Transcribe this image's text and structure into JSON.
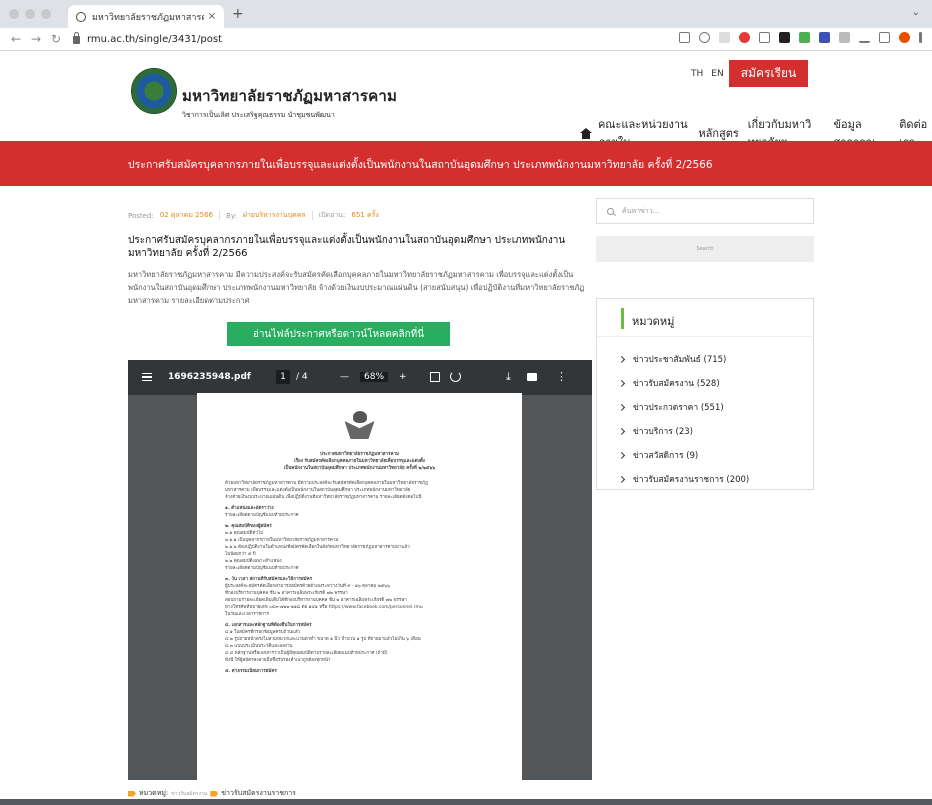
{
  "browser": {
    "tab_title": "มหาวิทยาลัยราชภัฏมหาสารคาม - (",
    "tab_close": "×",
    "new_tab": "+",
    "url": "rmu.ac.th/single/3431/post"
  },
  "header": {
    "brand_name": "มหาวิทยาลัยราชภัฏมหาสารคาม",
    "brand_tagline": "วิชาการเป็นเลิศ ประเสริฐคุณธรรม นำชุมชนพัฒนา",
    "lang_th": "TH",
    "lang_en": "EN",
    "apply_label": "สมัครเรียน",
    "nav": [
      "คณะและหน่วยงานภายใน",
      "หลักสูตร",
      "เกี่ยวกับมหาวิทยาลัยฯ",
      "ข้อมูลสาธารณะ",
      "ติดต่อเรา"
    ]
  },
  "banner": {
    "title": "ประกาศรับสมัครบุคลากรภายในเพื่อบรรจุและแต่งตั้งเป็นพนักงานในสถาบันอุดมศึกษา ประเภทพนักงานมหาวิทยาลัย ครั้งที่ 2/2566"
  },
  "post": {
    "posted_label": "Posted:",
    "posted_date": "02 ตุลาคม 2566",
    "by_label": "By:",
    "author": "ฝ่ายบริหารงานบุคคล",
    "views_label": "เปิดอ่าน:",
    "views": "651 ครั้ง",
    "title": "ประกาศรับสมัครบุคลากรภายในเพื่อบรรจุและแต่งตั้งเป็นพนักงานในสถาบันอุดมศึกษา ประเภทพนักงานมหาวิทยาลัย ครั้งที่ 2/2566",
    "body": "มหาวิทยาลัยราชภัฏมหาสารคาม มีความประสงค์จะรับสมัครคัดเลือกบุคคลภายในมหาวิทยาลัยราชภัฏมหาสารคาม เพื่อบรรจุและแต่งตั้งเป็นพนักงานในสถาบันอุดมศึกษา ประเภทพนักงานมหาวิทยาลัย จ้างด้วยเงินงบประมาณแผ่นดิน (สายสนับสนุน) เพื่อปฏิบัติงานที่มหาวิทยาลัยราชภัฏมหาสารคาม รายละเอียดตามประกาศ",
    "download_label": "อ่านไฟล์ประกาศหรือดาวน์โหลดคลิกที่นี่",
    "category_label": "หมวดหมู่:",
    "category_small": "ข่าวรับสมัครงาน",
    "category_main": "ข่าวรับสมัครงานราชการ"
  },
  "pdf": {
    "filename": "1696235948.pdf",
    "page_current": "1",
    "page_total": "/ 4",
    "zoom_minus": "—",
    "zoom": "68%",
    "zoom_plus": "+",
    "doc_heading": [
      "ประกาศมหาวิทยาลัยราชภัฏมหาสารคาม",
      "เรื่อง รับสมัครคัดเลือกบุคคลภายในมหาวิทยาลัยเพื่อบรรจุและแต่งตั้ง",
      "เป็นพนักงานในสถาบันอุดมศึกษา ประเภทพนักงานมหาวิทยาลัย ครั้งที่ ๒/๒๕๖๖"
    ],
    "doc_lines": [
      "ด้วยมหาวิทยาลัยราชภัฏมหาสารคาม มีความประสงค์จะรับสมัครคัดเลือกบุคคลภายในมหาวิทยาลัยราชภัฏ",
      "มหาสารคาม เพื่อบรรจุและแต่งตั้งเป็นพนักงานในสถาบันอุดมศึกษา ประเภทพนักงานมหาวิทยาลัย",
      "จ้างด้วยเงินงบประมาณแผ่นดิน เพื่อปฏิบัติงานที่มหาวิทยาลัยราชภัฏมหาสารคาม รายละเอียดดังต่อไปนี้",
      "๑. ตำแหน่งและอัตราว่าง",
      "รายละเอียดตามบัญชีแนบท้ายประกาศ",
      "๒. คุณสมบัติของผู้สมัคร",
      "๒.๑ คุณสมบัติทั่วไป",
      "๒.๑.๑ เป็นบุคลากรภายในมหาวิทยาลัยราชภัฏมหาสารคาม",
      "๒.๑.๒ ต้องปฏิบัติงานในตำแหน่งที่สมัครคัดเลือกในสังกัดมหาวิทยาลัยราชภัฏมหาสารคามมาแล้ว",
      "ไม่น้อยกว่า ๕ ปี",
      "๒.๒ คุณสมบัติเฉพาะตำแหน่ง",
      "รายละเอียดตามบัญชีแนบท้ายประกาศ",
      "๓. วัน เวลา สถานที่รับสมัครและวิธีการสมัคร",
      "ผู้ประสงค์จะสมัครคัดเลือกสามารถสมัครด้วยตัวเองระหว่างวันที่ ๙ - ๑๖ ตุลาคม ๒๕๖๖",
      "ที่กองบริหารงานบุคคล ชั้น ๒ อาคารเฉลิมพระเกียรติ ๗๒ พรรษา",
      "สอบถามรายละเอียดเพิ่มเติมได้ที่กองบริหารงานบุคคล ชั้น ๒ อาคารเฉลิมพระเกียรติ ๗๒ พรรษา",
      "ทางโทรศัพท์หมายเลข ๐๔๓-๗๒๒-๑๑๘ ต่อ ๑๔๑ หรือ https://www.facebook.com/personnel.rmu",
      "ในวันและเวลาราชการ",
      "๔. เอกสารและหลักฐานที่ต้องยื่นในการสมัคร",
      "๔.๑ ใบสมัครที่กรอกข้อมูลครบถ้วนแล้ว",
      "๔.๒ รูปถ่ายหน้าตรงไม่สวมหมวกและแว่นตาดำ ขนาด ๑ นิ้ว จำนวน ๑ รูป ที่ถ่ายมาแล้วไม่เกิน ๖ เดือน",
      "๔.๓ แบบประเมินประวัติและผลงาน",
      "๔.๔ หลักฐานหรือเอกสารว่าเป็นผู้มีคุณสมบัติตามรายละเอียดแนบท้ายประกาศ (ถ้ามี)",
      "ทั้งนี้ ให้ผู้สมัครลงลายมือชื่อรับรองสำเนาถูกต้องทุกหน้า",
      "๕. ค่าธรรมเนียมการสมัคร"
    ]
  },
  "sidebar": {
    "search_placeholder": "ค้นหาข่าว...",
    "search_button": "Search",
    "categories_title": "หมวดหมู่",
    "categories": [
      "ข่าวประชาสัมพันธ์ (715)",
      "ข่าวรับสมัครงาน (528)",
      "ข่าวประกวดราคา (551)",
      "ข่าวบริการ (23)",
      "ข่าวสวัสดิการ (9)",
      "ข่าวรับสมัครงานราชการ (200)"
    ]
  },
  "colors": {
    "brand_red": "#d32f2f",
    "download_green": "#27ae60",
    "accent_orange": "#e08a1e",
    "category_bar": "#6abf40"
  }
}
